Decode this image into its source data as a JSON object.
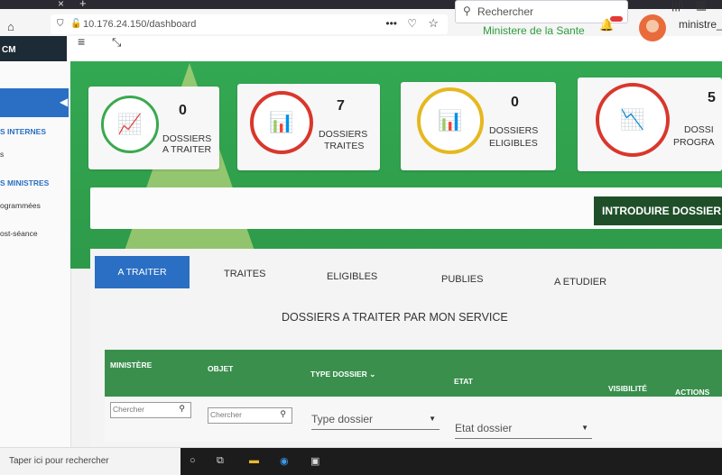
{
  "browser": {
    "url": "10.176.24.150/dashboard",
    "search_placeholder": "Rechercher",
    "home_glyph": "⌂",
    "dots_glyph": "•••",
    "pocket_glyph": "♡",
    "star_glyph": "☆",
    "close_glyph": "×",
    "newtab_glyph": "+",
    "library_glyph": "|||\\",
    "sidebar_glyph": "▥"
  },
  "header": {
    "brand": "CM",
    "ministry": "Ministere de la Sante",
    "user": "ministre_",
    "menu_glyph": "≡",
    "expand_glyph": "⤡",
    "bell_glyph": "🔔"
  },
  "sidebar": {
    "items": [
      {
        "label": "S INTERNES",
        "type": "section"
      },
      {
        "label": "s",
        "type": "link"
      },
      {
        "label": "S MINISTRES",
        "type": "section"
      },
      {
        "label": "ogrammées",
        "type": "link"
      },
      {
        "label": "ost-séance",
        "type": "link"
      }
    ]
  },
  "stats": [
    {
      "value": "0",
      "line1": "DOSSIERS",
      "line2": "A TRAITER",
      "color": "#3aa94f",
      "icon": "chart-line-icon"
    },
    {
      "value": "7",
      "line1": "DOSSIERS",
      "line2": "TRAITES",
      "color": "#d9372c",
      "icon": "bar-chart-icon"
    },
    {
      "value": "0",
      "line1": "DOSSIERS",
      "line2": "ELIGIBLES",
      "color": "#e6b81e",
      "icon": "bar-chart-icon"
    },
    {
      "value": "5",
      "line1": "DOSSI",
      "line2": "PROGRA",
      "color": "#d9372c",
      "icon": "line-graph-icon"
    }
  ],
  "actions": {
    "introduce_label": "INTRODUIRE DOSSIER"
  },
  "tabs": [
    {
      "label": "A TRAITER",
      "active": true
    },
    {
      "label": "TRAITES",
      "active": false
    },
    {
      "label": "ELIGIBLES",
      "active": false
    },
    {
      "label": "PUBLIES",
      "active": false
    },
    {
      "label": "A ETUDIER",
      "active": false
    }
  ],
  "panel": {
    "title": "DOSSIERS A TRAITER PAR MON SERVICE"
  },
  "table": {
    "headers": [
      "MINISTÈRE",
      "OBJET",
      "TYPE DOSSIER",
      "ETAT",
      "VISIBILITÉ",
      "ACTIONS"
    ],
    "filters": {
      "ministere_placeholder": "Chercher",
      "objet_placeholder": "Chercher",
      "type_placeholder": "Type dossier",
      "etat_placeholder": "Etat dossier"
    }
  },
  "taskbar": {
    "search_text": "Taper ici pour rechercher"
  }
}
